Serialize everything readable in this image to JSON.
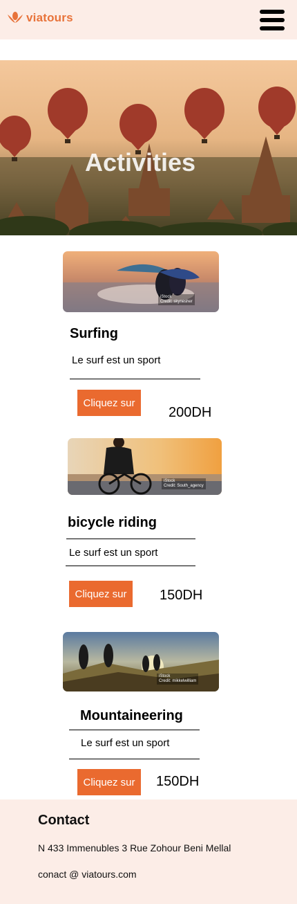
{
  "brand": {
    "name": "viatours",
    "color": "#e8733a",
    "icon": "lotus-logo-icon"
  },
  "header": {
    "menu_icon": "hamburger-menu-icon"
  },
  "hero": {
    "title": "Activities"
  },
  "activities": [
    {
      "title": "Surfing",
      "description": "Le surf est un sport",
      "button": "Cliquez sur",
      "price": "200DH",
      "image_badge": "iStock",
      "image_credit": "Credit: skynesher"
    },
    {
      "title": "bicycle riding",
      "description": "Le surf est un sport",
      "button": "Cliquez sur",
      "price": "150DH",
      "image_badge": "iStock",
      "image_credit": "Credit: South_agency"
    },
    {
      "title": "Mountaineering",
      "description": "Le surf est un sport",
      "button": "Cliquez sur",
      "price": "150DH",
      "image_badge": "iStock",
      "image_credit": "Credit: mikkelwilliam"
    }
  ],
  "footer": {
    "title": "Contact",
    "address": "N 433 Immenubles 3 Rue Zohour Beni Mellal",
    "email": "conact @ viatours.com"
  },
  "colors": {
    "accent": "#ea6a2f",
    "header_bg": "#fcede7"
  }
}
